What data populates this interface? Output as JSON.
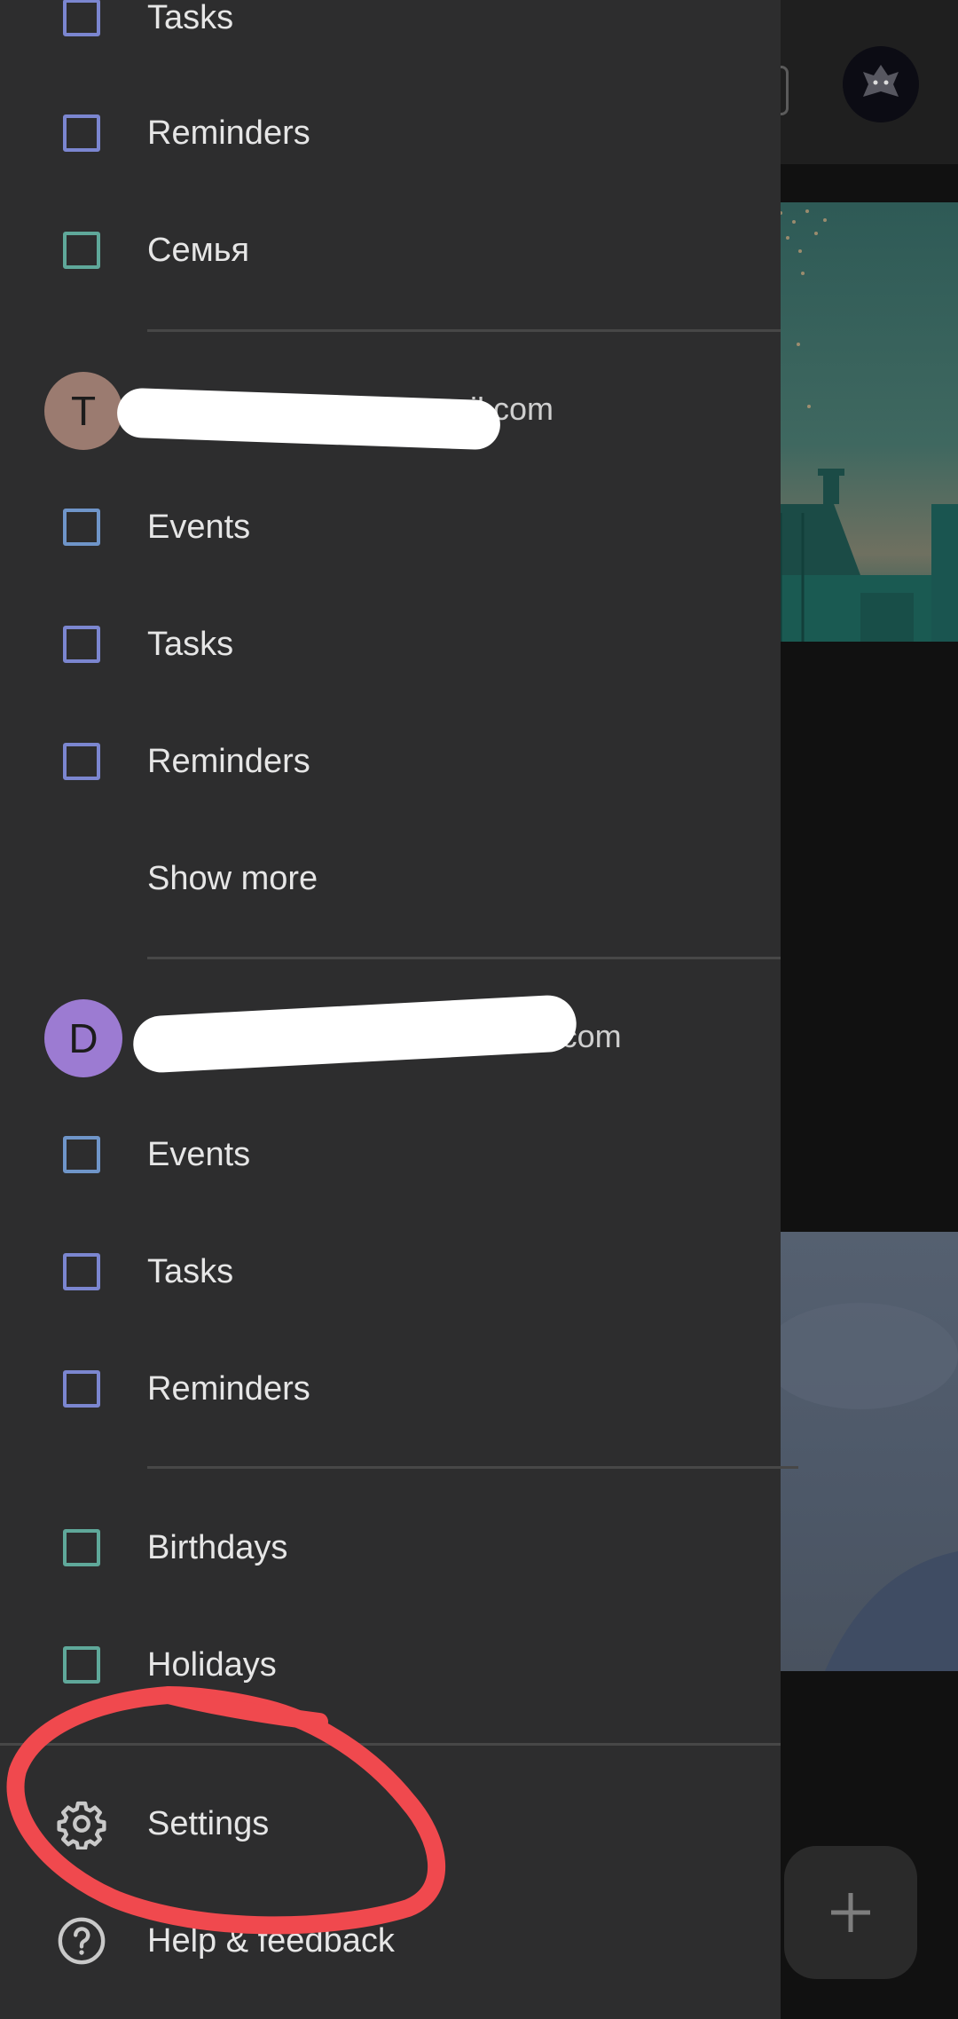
{
  "drawer": {
    "top_items": [
      {
        "label": "Tasks"
      },
      {
        "label": "Reminders"
      },
      {
        "label": "Семья"
      }
    ],
    "account_1": {
      "initial": "T",
      "email_visible": "il.com",
      "avatar_color": "#9b7b70",
      "items": [
        {
          "label": "Events"
        },
        {
          "label": "Tasks"
        },
        {
          "label": "Reminders"
        }
      ],
      "show_more": "Show more"
    },
    "account_2": {
      "initial": "D",
      "email_visible": "@gmail.com",
      "avatar_color": "#9c7bd2",
      "items": [
        {
          "label": "Events"
        },
        {
          "label": "Tasks"
        },
        {
          "label": "Reminders"
        }
      ]
    },
    "other_calendars": [
      {
        "label": "Birthdays"
      },
      {
        "label": "Holidays"
      }
    ],
    "settings_label": "Settings",
    "help_label": "Help & feedback"
  },
  "colors": {
    "drawer_bg": "#2d2d2e",
    "annotation": "#f0494e",
    "checkbox_violet": "#7b86d0",
    "checkbox_teal": "#5fa89a",
    "checkbox_blue": "#6f95c9"
  },
  "fab": {
    "icon": "plus-icon"
  }
}
